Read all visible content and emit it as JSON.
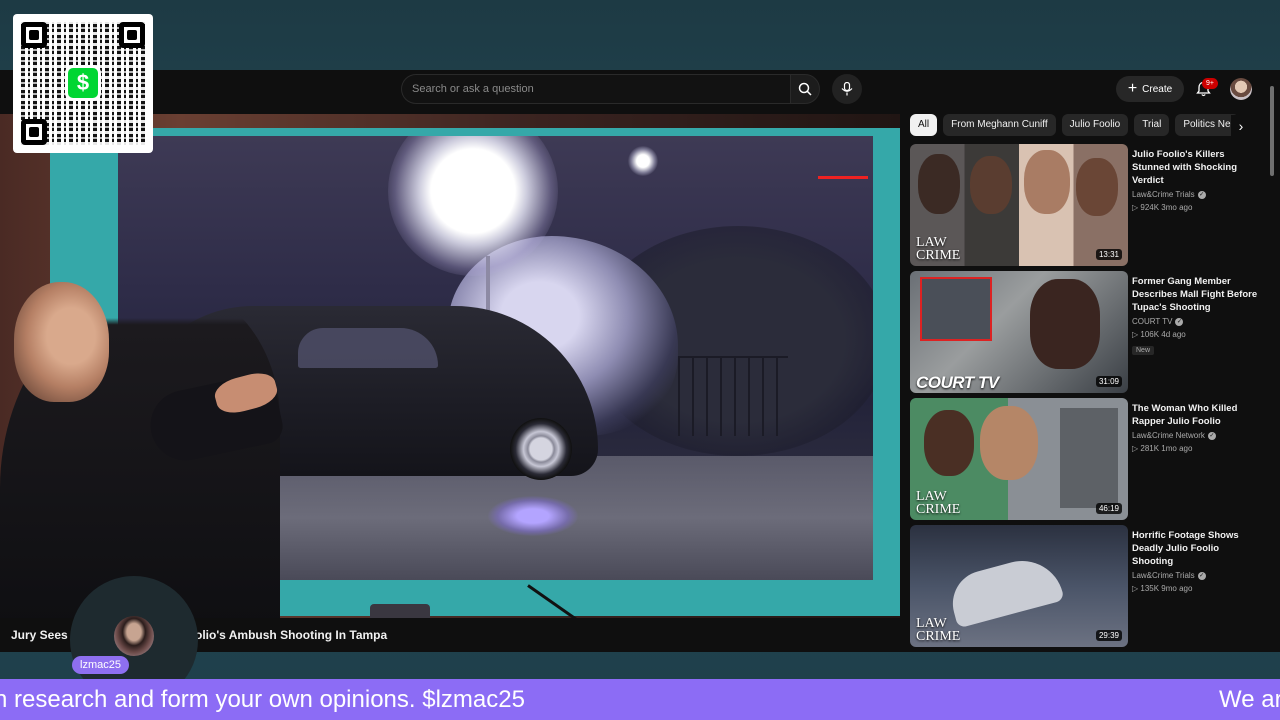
{
  "search": {
    "placeholder": "Search or ask a question"
  },
  "header": {
    "create_label": "Create",
    "notification_count": "9+",
    "icons": [
      "search-icon",
      "mic-icon",
      "plus-icon",
      "bell-icon",
      "avatar"
    ]
  },
  "chips": [
    "All",
    "From Meghann Cuniff",
    "Julio Foolio",
    "Trial",
    "Politics Ne"
  ],
  "video": {
    "title_left": "Jury Sees",
    "title_right": "olio's Ambush Shooting In Tampa"
  },
  "recommendations": [
    {
      "title": "Julio Foolio's Killers Stunned with Shocking Verdict",
      "channel": "Law&Crime Trials",
      "stats": "▷ 924K  3mo ago",
      "duration": "13:31",
      "brand": "LAW CRIME",
      "badge": ""
    },
    {
      "title": "Former Gang Member Describes Mall Fight Before Tupac's Shooting",
      "channel": "COURT TV",
      "stats": "▷ 106K  4d ago",
      "duration": "31:09",
      "brand": "COURT TV",
      "badge": "New"
    },
    {
      "title": "The Woman Who Killed Rapper Julio Foolio",
      "channel": "Law&Crime Network",
      "stats": "▷ 281K  1mo ago",
      "duration": "46:19",
      "brand": "LAW CRIME",
      "badge": ""
    },
    {
      "title": "Horrific Footage Shows Deadly Julio Foolio Shooting",
      "channel": "Law&Crime Trials",
      "stats": "▷ 135K  9mo ago",
      "duration": "29:39",
      "brand": "LAW CRIME",
      "badge": ""
    }
  ],
  "overlay": {
    "cashapp_symbol": "$",
    "streamer_name": "lzmac25",
    "ticker_text": "n research and form your own opinions. $lzmac25",
    "ticker_text_next": "We ar"
  },
  "colors": {
    "ticker_bg": "#8c6cf5",
    "youtube_bg": "#0f0f0f",
    "teal_screen": "#35a8a9",
    "cashapp_green": "#00d632"
  }
}
